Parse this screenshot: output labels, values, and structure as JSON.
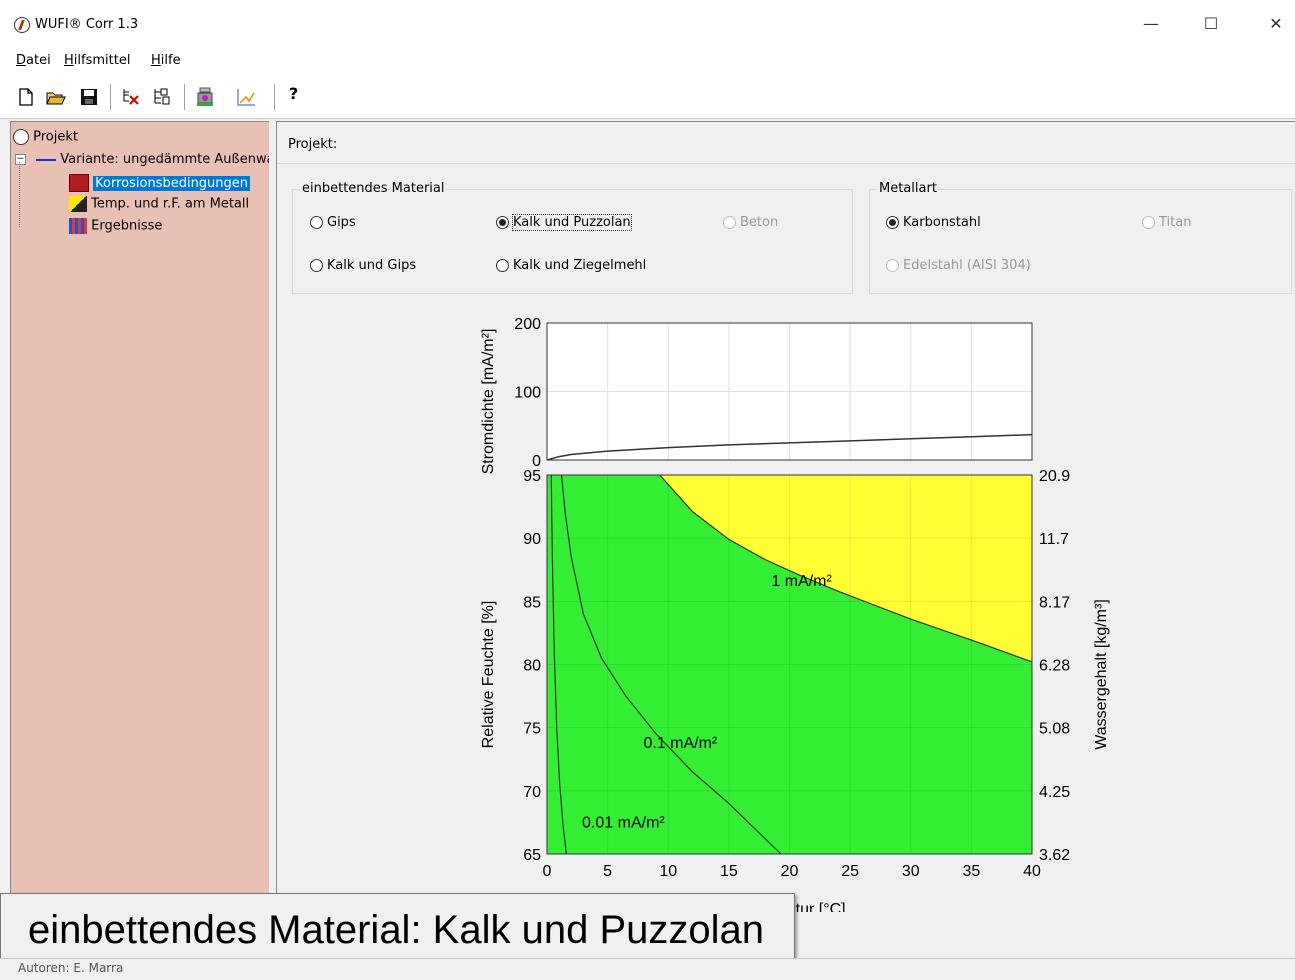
{
  "window": {
    "title": "WUFI® Corr 1.3",
    "minimize": "—",
    "maximize": "☐",
    "close": "✕"
  },
  "menu": [
    {
      "label_pre": "",
      "label_ul": "D",
      "label_post": "atei"
    },
    {
      "label_pre": "",
      "label_ul": "H",
      "label_post": "ilfsmittel"
    },
    {
      "label_pre": "",
      "label_ul": "H",
      "label_post": "ilfe"
    }
  ],
  "toolbar": {
    "icons": [
      "new-file-icon",
      "open-folder-icon",
      "save-icon",
      "delete-variant-icon",
      "copy-variant-icon",
      "calculate-icon",
      "chart-icon",
      "help-icon"
    ],
    "help_label": "?"
  },
  "tree": {
    "root": "Projekt",
    "variant": "Variante: ungedämmte Außenwand",
    "children": [
      "Korrosionsbedingungen",
      "Temp. und r.F. am Metall",
      "Ergebnisse"
    ]
  },
  "main": {
    "header": "Projekt:",
    "material_group": {
      "title": "einbettendes Material",
      "options": [
        {
          "label": "Gips",
          "checked": false,
          "disabled": false
        },
        {
          "label": "Kalk und Puzzolan",
          "checked": true,
          "disabled": false
        },
        {
          "label": "Beton",
          "checked": false,
          "disabled": true
        },
        {
          "label": "Kalk und Gips",
          "checked": false,
          "disabled": false
        },
        {
          "label": "Kalk und Ziegelmehl",
          "checked": false,
          "disabled": false
        }
      ]
    },
    "metal_group": {
      "title": "Metallart",
      "options": [
        {
          "label": "Karbonstahl",
          "checked": true,
          "disabled": false
        },
        {
          "label": "Titan",
          "checked": false,
          "disabled": true
        },
        {
          "label": "Edelstahl (AISI 304)",
          "checked": false,
          "disabled": true
        }
      ]
    }
  },
  "chart_data": [
    {
      "type": "line",
      "ylabel": "Stromdichte [mA/m²]",
      "ylim": [
        0,
        200
      ],
      "yticks": [
        0,
        100,
        200
      ],
      "xlim": [
        0,
        40
      ],
      "grid": true,
      "series": [
        {
          "x": [
            0,
            1,
            2,
            5,
            10,
            15,
            20,
            25,
            30,
            35,
            40
          ],
          "y": [
            0,
            5,
            8,
            13,
            18,
            22,
            25,
            28,
            31,
            34,
            37
          ]
        }
      ]
    },
    {
      "type": "area",
      "xlabel": "Temperatur [°C]",
      "ylabel": "Relative Feuchte [%]",
      "y2label": "Wassergehalt [kg/m³]",
      "xlim": [
        0,
        40
      ],
      "ylim": [
        65,
        95
      ],
      "xticks": [
        0,
        5,
        10,
        15,
        20,
        25,
        30,
        35,
        40
      ],
      "yticks": [
        65,
        70,
        75,
        80,
        85,
        90,
        95
      ],
      "y2ticks": [
        "3.62",
        "4.25",
        "5.08",
        "6.28",
        "8.17",
        "11.7",
        "20.9"
      ],
      "grid": true,
      "colors": {
        "low": "#33ee33",
        "high": "#ffff33"
      },
      "contours": [
        {
          "label": "1 mA/m²",
          "label_x": 21,
          "label_y": 86.2,
          "x": [
            9.3,
            12,
            15,
            18,
            21,
            24,
            27,
            30,
            33,
            36,
            40
          ],
          "y": [
            95,
            92.1,
            89.9,
            88.3,
            87.0,
            85.8,
            84.7,
            83.6,
            82.6,
            81.6,
            80.2
          ]
        },
        {
          "label": "0.1 mA/m²",
          "label_x": 11,
          "label_y": 73.4,
          "x": [
            1.2,
            1.5,
            2,
            3,
            4.5,
            6.5,
            9,
            12,
            15,
            18,
            19.3
          ],
          "y": [
            95,
            92,
            88.5,
            84,
            80.5,
            77.5,
            74.5,
            71.5,
            69,
            66.2,
            65
          ]
        },
        {
          "label": "0.01 mA/m²",
          "label_x": 6.3,
          "label_y": 67.1,
          "x": [
            0.35,
            0.45,
            0.6,
            0.8,
            1.05,
            1.35,
            1.6
          ],
          "y": [
            95,
            88,
            81,
            75,
            70.5,
            67,
            65
          ]
        }
      ]
    }
  ],
  "tooltip": "einbettendes Material: Kalk und Puzzolan",
  "status": "Autoren: E. Marra"
}
